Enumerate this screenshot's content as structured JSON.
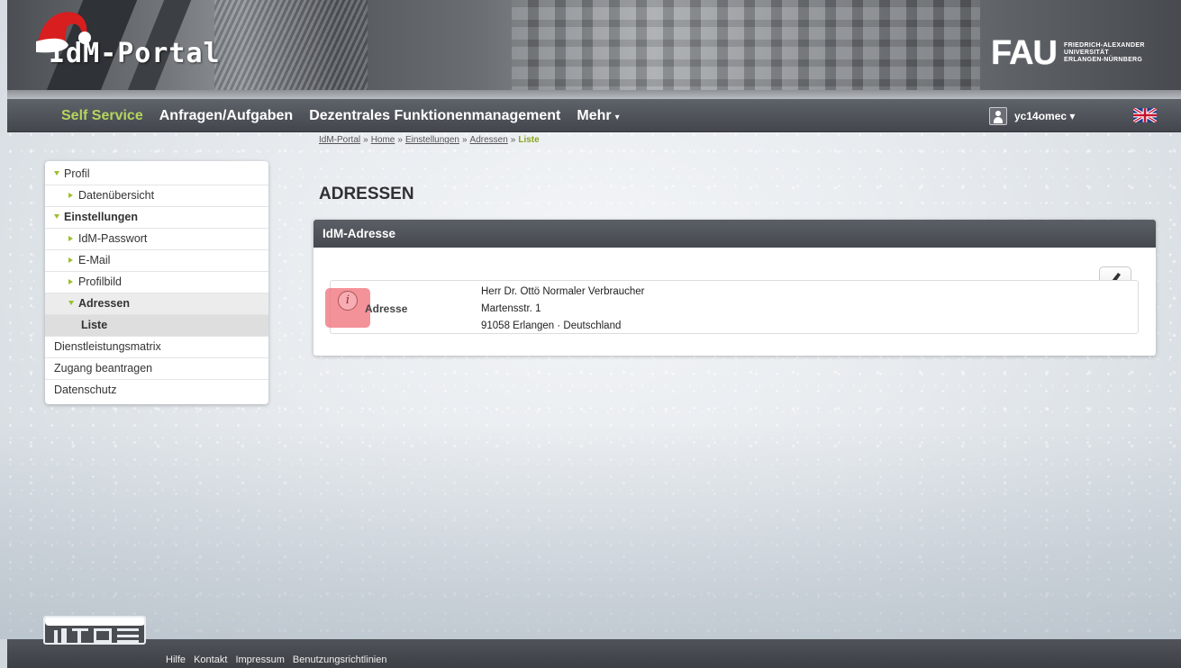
{
  "header": {
    "portal_title": "IdM-Portal",
    "logo_mark": "FAU",
    "logo_text_line1": "FRIEDRICH-ALEXANDER",
    "logo_text_line2": "UNIVERSITÄT",
    "logo_text_line3": "ERLANGEN-NÜRNBERG"
  },
  "nav": {
    "items": [
      {
        "label": "Self Service",
        "active": true
      },
      {
        "label": "Anfragen/Aufgaben"
      },
      {
        "label": "Dezentrales Funktionenmanagement"
      },
      {
        "label": "Mehr",
        "caret": "▾"
      }
    ],
    "user": "yc14omec ▾"
  },
  "breadcrumb": {
    "items": [
      "IdM-Portal",
      "Home",
      "Einstellungen",
      "Adressen"
    ],
    "separator": "»",
    "current": "Liste"
  },
  "sidebar": {
    "items": [
      {
        "label": "Profil"
      },
      {
        "label": "Datenübersicht"
      },
      {
        "label": "Einstellungen"
      },
      {
        "label": "IdM-Passwort"
      },
      {
        "label": "E-Mail"
      },
      {
        "label": "Profilbild"
      },
      {
        "label": "Adressen"
      },
      {
        "label": "Liste"
      },
      {
        "label": "Dienstleistungsmatrix"
      },
      {
        "label": "Zugang beantragen"
      },
      {
        "label": "Datenschutz"
      }
    ]
  },
  "main": {
    "page_title": "ADRESSEN",
    "panel_title": "IdM-Adresse",
    "address_label": "Adresse",
    "address_lines": [
      "Herr Dr. Ottö Normaler Verbraucher",
      "Martensstr. 1",
      "91058 Erlangen · Deutschland"
    ],
    "info_glyph": "i"
  },
  "footer": {
    "links": [
      "Hilfe",
      "Kontakt",
      "Impressum",
      "Benutzungsrichtlinien"
    ]
  },
  "icons": {
    "edit": "pencil-icon",
    "info": "info-icon",
    "user": "user-icon",
    "flag": "uk-flag-icon",
    "hat": "santa-hat-icon"
  },
  "colors": {
    "accent_green": "#9cbf2e",
    "nav_active": "#b6d55e",
    "panel_header": "#4f5359",
    "highlight": "#f06e78"
  }
}
